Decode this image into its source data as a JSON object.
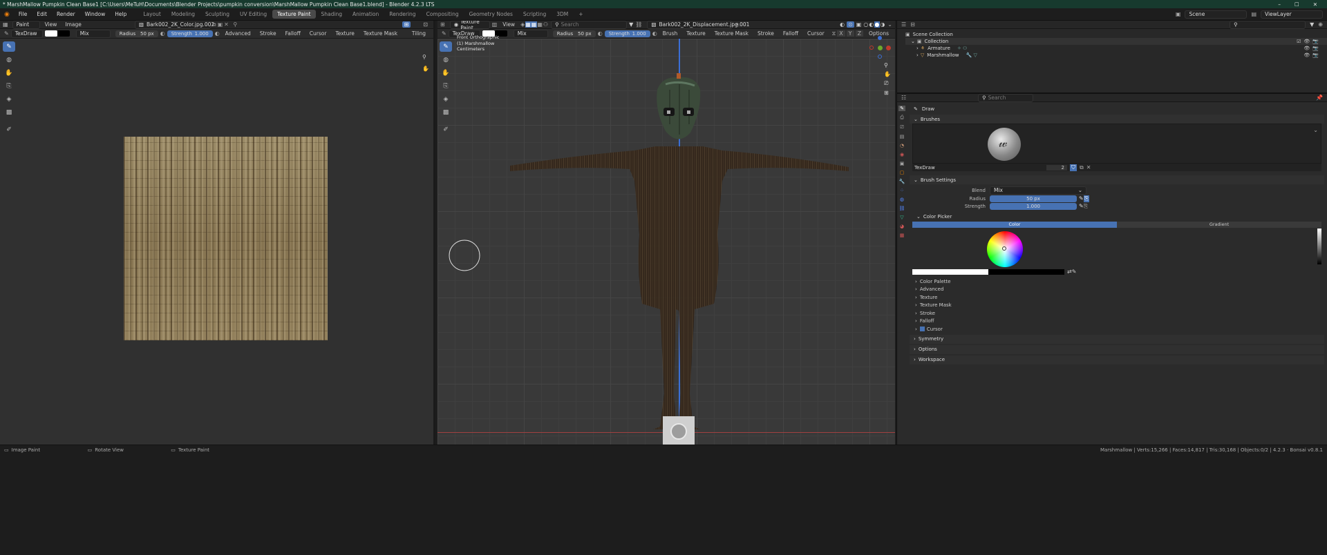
{
  "titlebar": {
    "title": "* MarshMallow Pumpkin Clean Base1 [C:\\Users\\MeTuH\\Documents\\Blender Projects\\pumpkin conversion\\MarshMallow Pumpkin Clean Base1.blend] - Blender 4.2.3 LTS"
  },
  "menu": [
    "File",
    "Edit",
    "Render",
    "Window",
    "Help"
  ],
  "workspaces": [
    {
      "label": "Layout"
    },
    {
      "label": "Modeling"
    },
    {
      "label": "Sculpting"
    },
    {
      "label": "UV Editing"
    },
    {
      "label": "Texture Paint",
      "active": true
    },
    {
      "label": "Shading"
    },
    {
      "label": "Animation"
    },
    {
      "label": "Rendering"
    },
    {
      "label": "Compositing"
    },
    {
      "label": "Geometry Nodes"
    },
    {
      "label": "Scripting"
    },
    {
      "label": "3DM"
    }
  ],
  "scene": {
    "name": "Scene",
    "view_layer": "ViewLayer"
  },
  "image_editor": {
    "mode": "Paint",
    "menus": [
      "View",
      "Image"
    ],
    "image_name": "Bark002_2K_Color.jpg.002",
    "brush": "TexDraw",
    "blend": "Mix",
    "radius_label": "Radius",
    "radius": "50 px",
    "strength_label": "Strength",
    "strength": "1.000",
    "strength_fraction": 1.0,
    "dropdowns": [
      "Advanced",
      "Stroke",
      "Falloff",
      "Cursor",
      "Texture",
      "Texture Mask"
    ],
    "tiling": "Tiling"
  },
  "viewport": {
    "mode": "Texture Paint",
    "menu": "View",
    "search_placeholder": "Search",
    "image_name": "Bark002_2K_Displacement.jpg.001",
    "brush": "TexDraw",
    "blend": "Mix",
    "radius_label": "Radius",
    "radius": "50 px",
    "strength_label": "Strength",
    "strength": "1.000",
    "strength_fraction": 1.0,
    "dropdowns": [
      "Brush",
      "Texture",
      "Texture Mask",
      "Stroke",
      "Falloff",
      "Cursor"
    ],
    "options": "Options",
    "axes": [
      "X",
      "Y",
      "Z"
    ],
    "overlay": {
      "view": "Front Orthographic",
      "object": "(1) Marshmallow",
      "units": "Centimeters"
    }
  },
  "outliner": {
    "root": "Scene Collection",
    "collection": "Collection",
    "items": [
      "Armature",
      "Marshmallow"
    ]
  },
  "properties": {
    "search_placeholder": "Search",
    "tool": "Draw",
    "brushes_panel": "Brushes",
    "brush_name": "TexDraw",
    "brush_users": "2",
    "brush_settings_panel": "Brush Settings",
    "blend_label": "Blend",
    "blend": "Mix",
    "radius_label": "Radius",
    "radius": "50 px",
    "radius_fraction": 0.05,
    "strength_label": "Strength",
    "strength": "1.000",
    "strength_fraction": 1.0,
    "color_picker": "Color Picker",
    "tabs": [
      "Color",
      "Gradient"
    ],
    "subpanels": [
      "Color Palette",
      "Advanced",
      "Texture",
      "Texture Mask",
      "Stroke",
      "Falloff",
      "Cursor"
    ],
    "panels": [
      "Symmetry",
      "Options",
      "Workspace"
    ]
  },
  "statusbar": {
    "left": [
      "Image Paint",
      "Rotate View",
      "Texture Paint"
    ],
    "right": "Marshmallow | Verts:15,266 | Faces:14,817 | Tris:30,168 | Objects:0/2 | 4.2.3 · Bonsai v0.8.1"
  },
  "colors": {
    "accent": "#4772b3",
    "titlebar": "#173a2e",
    "x_axis": "#c0392b",
    "y_axis": "#6ea82b",
    "z_axis": "#3b6fd6"
  }
}
